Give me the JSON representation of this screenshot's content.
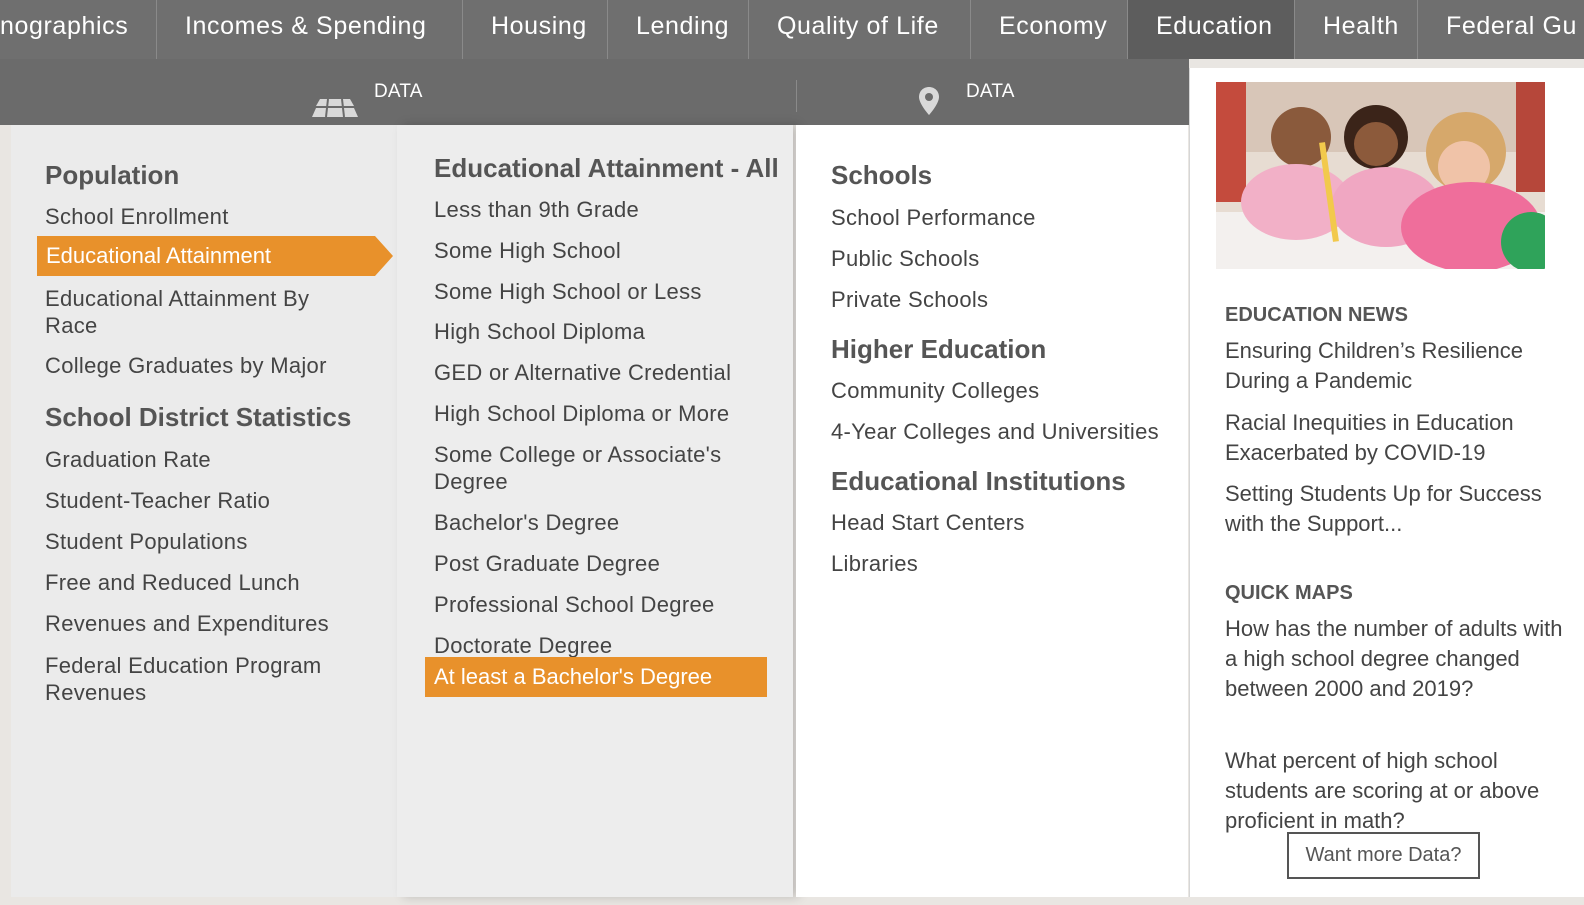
{
  "topnav": {
    "tabs": [
      {
        "label": "nographics"
      },
      {
        "label": "Incomes & Spending"
      },
      {
        "label": "Housing"
      },
      {
        "label": "Lending"
      },
      {
        "label": "Quality of Life"
      },
      {
        "label": "Economy"
      },
      {
        "label": "Education",
        "active": true
      },
      {
        "label": "Health"
      },
      {
        "label": "Federal Gu"
      }
    ]
  },
  "subbar": {
    "data_layers_label": "DATA LAYERS",
    "data_points_label": "DATA POINTS",
    "layers_icon": "layers-icon",
    "pin_icon": "map-pin-icon"
  },
  "layers": {
    "population_heading": "Population",
    "population_items": [
      "School Enrollment",
      "Educational Attainment",
      "Educational Attainment By Race",
      "College Graduates by Major"
    ],
    "district_heading": "School District Statistics",
    "district_items": [
      "Graduation Rate",
      "Student-Teacher Ratio",
      "Student Populations",
      "Free and Reduced Lunch",
      "Revenues and Expenditures",
      "Federal Education Program Revenues"
    ]
  },
  "attainment": {
    "heading": "Educational Attainment - All",
    "items": [
      "Less than 9th Grade",
      "Some High School",
      "Some High School or Less",
      "High School Diploma",
      "GED or Alternative Credential",
      "High School Diploma or More",
      "Some College or Associate's Degree",
      "Bachelor's Degree",
      "Post Graduate Degree",
      "Professional School Degree",
      "Doctorate Degree",
      "At least a Bachelor's Degree"
    ]
  },
  "points": {
    "schools_heading": "Schools",
    "schools_items": [
      "School Performance",
      "Public Schools",
      "Private Schools"
    ],
    "higher_heading": "Higher Education",
    "higher_items": [
      "Community Colleges",
      "4-Year Colleges and Universities"
    ],
    "institutions_heading": "Educational Institutions",
    "institutions_items": [
      "Head Start Centers",
      "Libraries"
    ]
  },
  "news": {
    "heading": "EDUCATION NEWS",
    "items": [
      "Ensuring Children’s Resilience During a Pandemic",
      "Racial Inequities in Education Exacerbated by COVID-19",
      "Setting Students Up for Success with the Support..."
    ],
    "quick_heading": "QUICK MAPS",
    "quick_items": [
      "How has the number of adults with a high school degree changed between 2000 and 2019?",
      "What percent of high school students are scoring at or above proficient in math?"
    ],
    "more_button": "Want more Data?"
  },
  "colors": {
    "accent": "#e8912b",
    "nav": "#6f6f6f"
  }
}
